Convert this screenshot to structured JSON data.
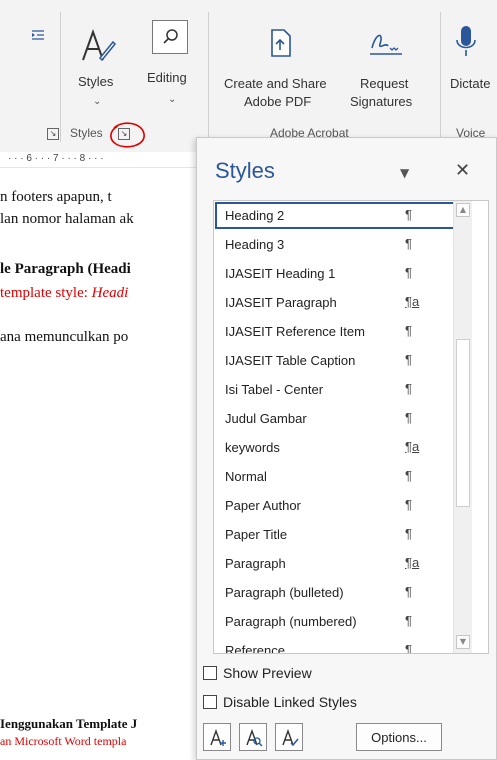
{
  "ribbon": {
    "styles_button": "Styles",
    "editing_button": "Editing",
    "create_share_line1": "Create and Share",
    "create_share_line2": "Adobe PDF",
    "request_line1": "Request",
    "request_line2": "Signatures",
    "dictate_button": "Dictate",
    "group_styles": "Styles",
    "group_adobe": "Adobe Acrobat",
    "group_voice": "Voice"
  },
  "ruler": {
    "marks": "· · · 6 · · · 7 · · · 8 · · ·"
  },
  "document": {
    "line1": "n footers apapun, t",
    "line2": "lan nomor halaman ak",
    "heading": "le Paragraph (Headi",
    "red_prefix": " template style: ",
    "red_italic": "Headi",
    "line4": "ana memunculkan po",
    "footer_heading": "Ienggunakan Template J",
    "footer_red": "an Microsoft Word templa"
  },
  "styles_pane": {
    "title": "Styles",
    "close_glyph": "✕",
    "items": [
      {
        "name": "Heading 2",
        "mark": "¶"
      },
      {
        "name": "Heading 3",
        "mark": "¶"
      },
      {
        "name": "IJASEIT Heading 1",
        "mark": "¶"
      },
      {
        "name": "IJASEIT Paragraph",
        "mark": "¶a"
      },
      {
        "name": "IJASEIT Reference Item",
        "mark": "¶"
      },
      {
        "name": "IJASEIT Table Caption",
        "mark": "¶"
      },
      {
        "name": "Isi Tabel - Center",
        "mark": "¶"
      },
      {
        "name": "Judul Gambar",
        "mark": "¶"
      },
      {
        "name": "keywords",
        "mark": "¶a"
      },
      {
        "name": "Normal",
        "mark": "¶"
      },
      {
        "name": "Paper Author",
        "mark": "¶"
      },
      {
        "name": "Paper Title",
        "mark": "¶"
      },
      {
        "name": "Paragraph",
        "mark": "¶a"
      },
      {
        "name": "Paragraph (bulleted)",
        "mark": "¶"
      },
      {
        "name": "Paragraph (numbered)",
        "mark": "¶"
      },
      {
        "name": "Reference",
        "mark": "¶"
      }
    ],
    "selected": "Heading 2",
    "show_preview": "Show Preview",
    "disable_linked": "Disable Linked Styles",
    "options_button": "Options..."
  },
  "colors": {
    "accent": "#2b579a",
    "annotation_red": "#e00000",
    "highlight_red": "#e00000"
  }
}
